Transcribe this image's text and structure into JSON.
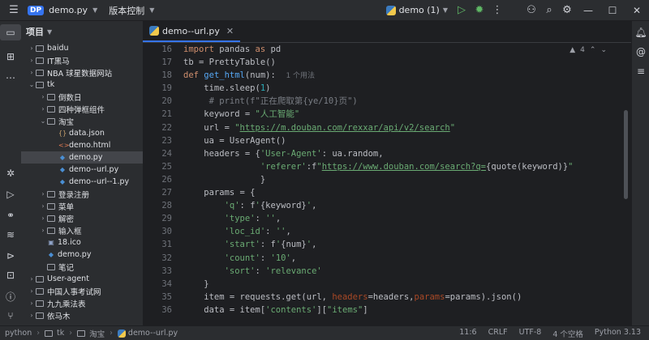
{
  "titlebar": {
    "project_badge": "DP",
    "project_name": "demo.py",
    "vcs_label": "版本控制",
    "run_config": "demo (1)"
  },
  "panel": {
    "title": "项目"
  },
  "tree": [
    {
      "label": "baidu",
      "kind": "folder",
      "level": 1,
      "expanded": false
    },
    {
      "label": "IT黑马",
      "kind": "folder",
      "level": 1,
      "expanded": false
    },
    {
      "label": "NBA 球星数据网站",
      "kind": "folder",
      "level": 1,
      "expanded": false
    },
    {
      "label": "tk",
      "kind": "folder",
      "level": 1,
      "expanded": true
    },
    {
      "label": "倒数日",
      "kind": "folder",
      "level": 2,
      "expanded": false
    },
    {
      "label": "四种弹框组件",
      "kind": "folder",
      "level": 2,
      "expanded": false
    },
    {
      "label": "淘宝",
      "kind": "folder",
      "level": 2,
      "expanded": true
    },
    {
      "label": "data.json",
      "kind": "json",
      "level": 3
    },
    {
      "label": "demo.html",
      "kind": "html",
      "level": 3
    },
    {
      "label": "demo.py",
      "kind": "py",
      "level": 3,
      "selected": true
    },
    {
      "label": "demo--url.py",
      "kind": "py",
      "level": 3
    },
    {
      "label": "demo--url--1.py",
      "kind": "py",
      "level": 3
    },
    {
      "label": "登录注册",
      "kind": "folder",
      "level": 2,
      "expanded": false
    },
    {
      "label": "菜单",
      "kind": "folder",
      "level": 2,
      "expanded": false
    },
    {
      "label": "解密",
      "kind": "folder",
      "level": 2,
      "expanded": false
    },
    {
      "label": "输入框",
      "kind": "folder",
      "level": 2,
      "expanded": false
    },
    {
      "label": "18.ico",
      "kind": "ico",
      "level": 2
    },
    {
      "label": "demo.py",
      "kind": "py",
      "level": 2
    },
    {
      "label": "笔记",
      "kind": "folder-plain",
      "level": 2
    },
    {
      "label": "User-agent",
      "kind": "folder",
      "level": 1,
      "expanded": false
    },
    {
      "label": "中国人事考试网",
      "kind": "folder",
      "level": 1,
      "expanded": false
    },
    {
      "label": "九九乘法表",
      "kind": "folder",
      "level": 1,
      "expanded": false
    },
    {
      "label": "依马木",
      "kind": "folder",
      "level": 1,
      "expanded": false
    }
  ],
  "editor": {
    "tab_label": "demo--url.py",
    "warnings": "4",
    "line_numbers": [
      "16",
      "17",
      "18",
      "19",
      "20",
      "21",
      "22",
      "23",
      "24",
      "25",
      "26",
      "27",
      "28",
      "29",
      "30",
      "31",
      "32",
      "33",
      "34",
      "35",
      "36"
    ]
  },
  "statusbar": {
    "crumbs": [
      "python",
      "tk",
      "淘宝",
      "demo--url.py"
    ],
    "position": "11:6",
    "line_sep": "CRLF",
    "encoding": "UTF-8",
    "indent": "4 个空格",
    "interpreter": "Python 3.13"
  },
  "colors": {
    "accent": "#3574f0",
    "keyword": "#cf8e6d",
    "string": "#6aab73",
    "number": "#2aacb8",
    "function": "#56a8f5",
    "comment": "#7a7e85"
  }
}
